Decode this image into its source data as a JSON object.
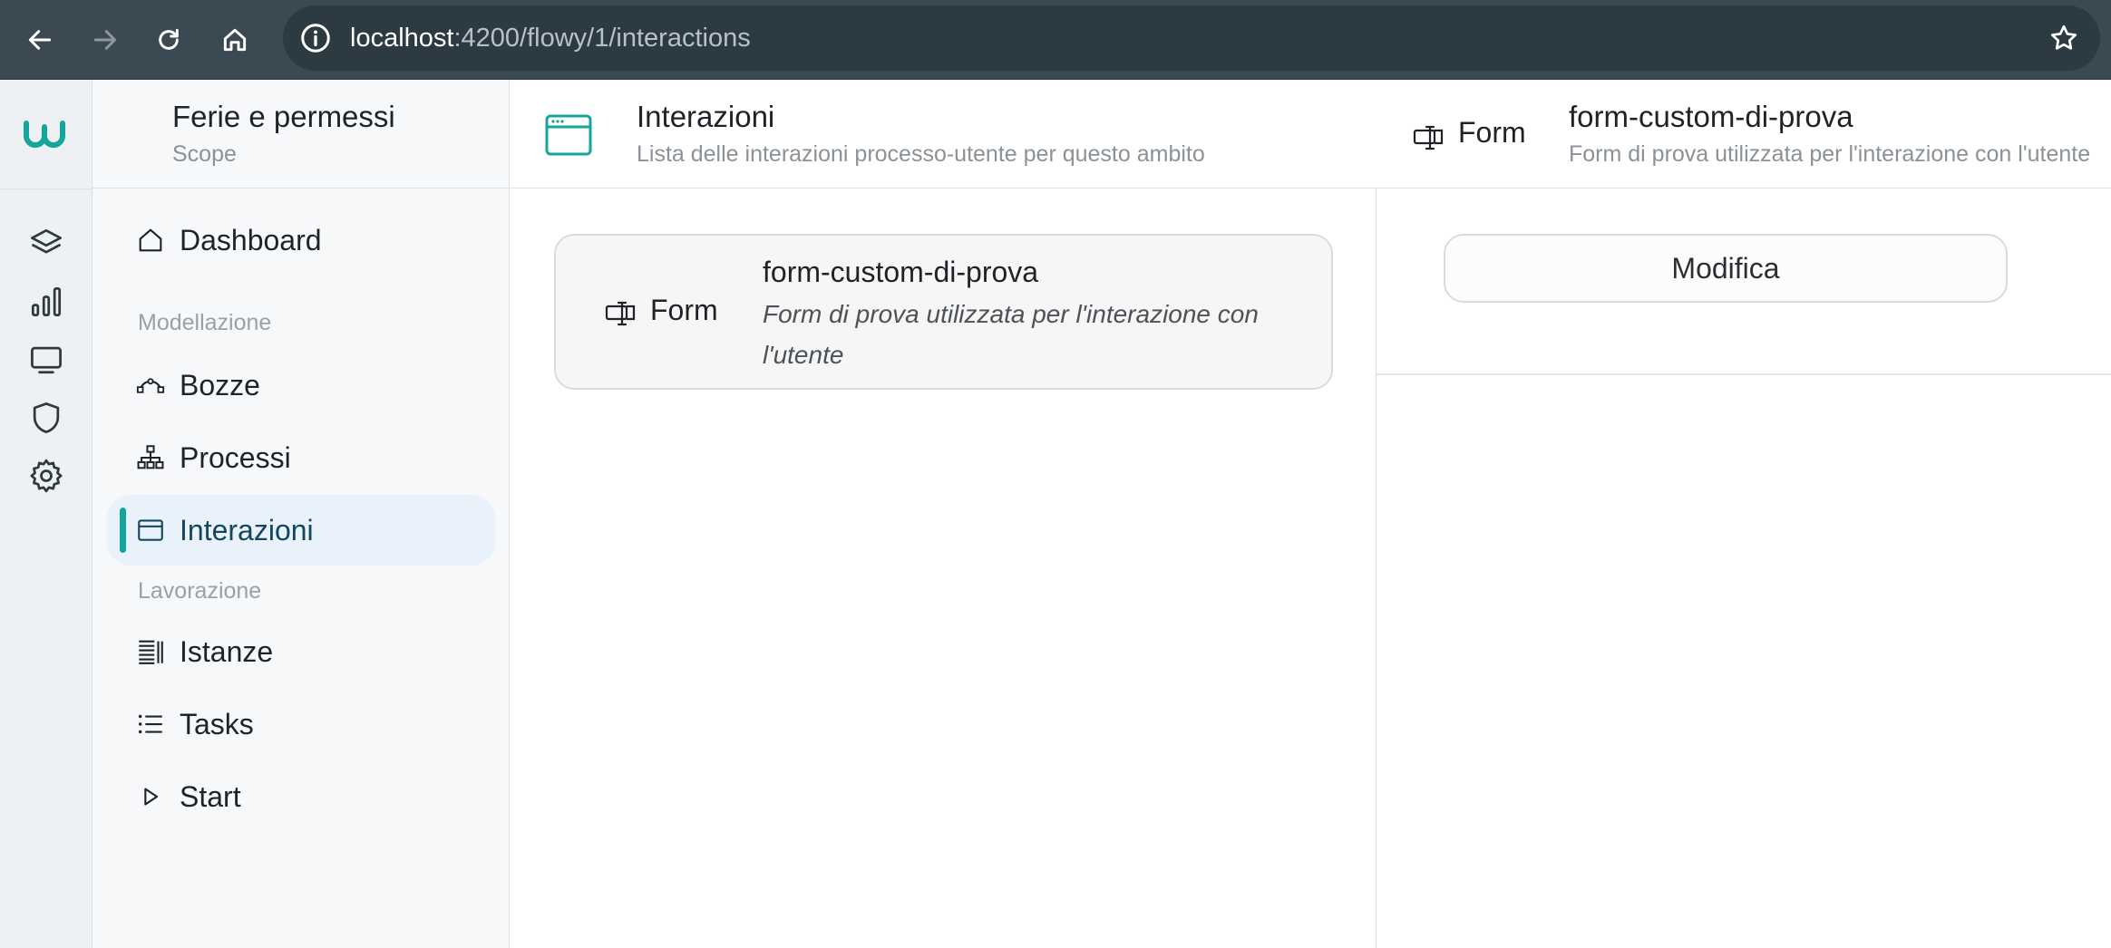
{
  "browser": {
    "url_host": "localhost",
    "url_path": ":4200/flowy/1/interactions"
  },
  "rail": {
    "logo": "w",
    "items": [
      "layers-icon",
      "chart-icon",
      "monitor-icon",
      "shield-icon",
      "gear-icon"
    ]
  },
  "sidebar": {
    "scope_title": "Ferie e permessi",
    "scope_subtitle": "Scope",
    "dashboard": "Dashboard",
    "section_modeling": "Modellazione",
    "bozze": "Bozze",
    "processi": "Processi",
    "interazioni": "Interazioni",
    "section_work": "Lavorazione",
    "istanze": "Istanze",
    "tasks": "Tasks",
    "start": "Start",
    "active_color": "#14a69a"
  },
  "main": {
    "title": "Interazioni",
    "subtitle": "Lista delle interazioni processo-utente per questo ambito",
    "cards": [
      {
        "type": "Form",
        "title": "form-custom-di-prova",
        "description": "Form di prova utilizzata per l'interazione con l'utente"
      }
    ]
  },
  "detail": {
    "type": "Form",
    "title": "form-custom-di-prova",
    "subtitle": "Form di prova utilizzata per l'interazione con l'utente",
    "edit_label": "Modifica"
  }
}
